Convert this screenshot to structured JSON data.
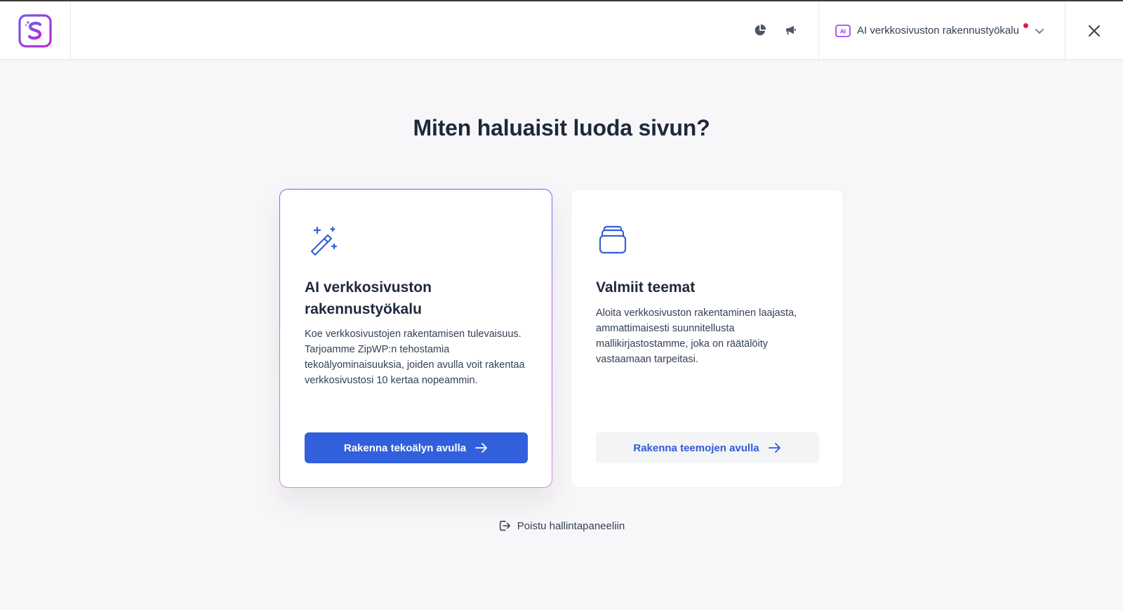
{
  "header": {
    "builder_label": "AI verkkosivuston rakennustyökalu",
    "ai_badge_text": "AI"
  },
  "main": {
    "title": "Miten haluaisit luoda sivun?",
    "cards": [
      {
        "title": "AI verkkosivuston rakennustyökalu",
        "description": "Koe verkkosivustojen rakentamisen tulevaisuus. Tarjoamme ZipWP:n tehostamia tekoälyominaisuuksia, joiden avulla voit rakentaa verkkosivustosi 10 kertaa nopeammin.",
        "button_label": "Rakenna tekoälyn avulla",
        "icon": "magic-wand-icon"
      },
      {
        "title": "Valmiit teemat",
        "description": "Aloita verkkosivuston rakentaminen laajasta, ammattimaisesti suunnitellusta mallikirjastostamme, joka on räätälöity vastaamaan tarpeitasi.",
        "button_label": "Rakenna teemojen avulla",
        "icon": "template-stack-icon"
      }
    ],
    "exit_label": "Poistu hallintapaneeliin"
  },
  "colors": {
    "accent": "#3260dc",
    "brand_purple": "#8b5cf6",
    "brand_pink": "#e879f9",
    "notification": "#e11d48"
  }
}
